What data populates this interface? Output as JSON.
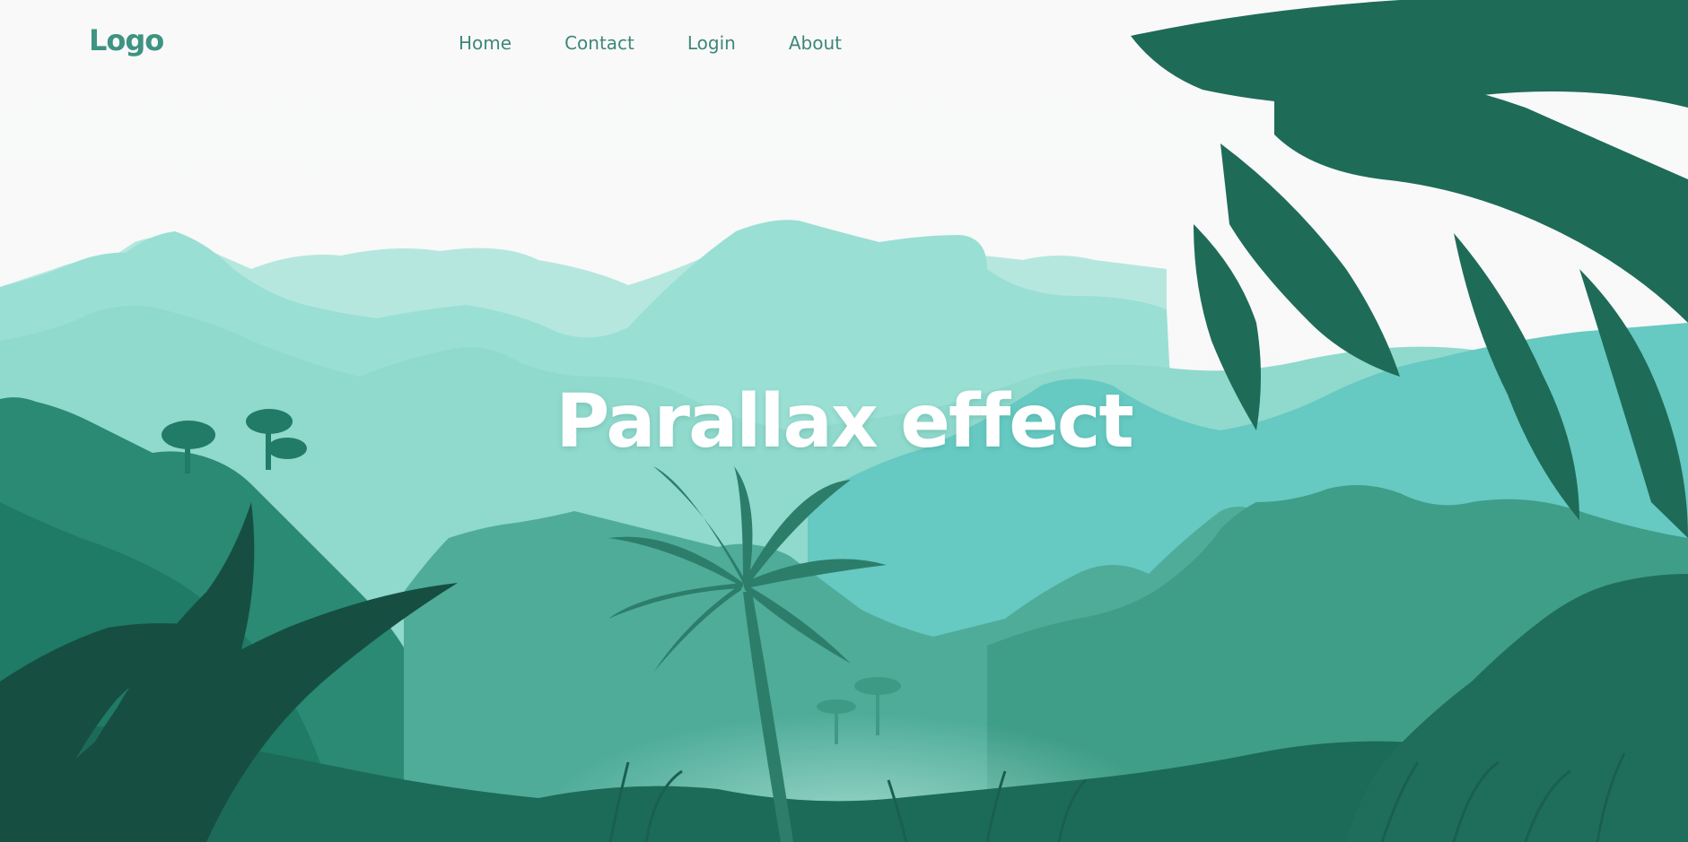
{
  "header": {
    "logo": "Logo",
    "nav": [
      {
        "label": "Home"
      },
      {
        "label": "Contact"
      },
      {
        "label": "Login"
      },
      {
        "label": "About"
      }
    ]
  },
  "hero": {
    "title": "Parallax effect"
  },
  "colors": {
    "background": "#f9f9f9",
    "accent": "#3e9382",
    "nav_text": "#3e8779",
    "title_text": "#ffffff"
  }
}
